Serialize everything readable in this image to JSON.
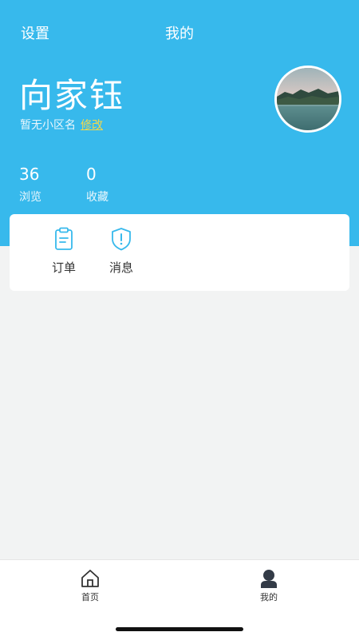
{
  "header": {
    "settings_label": "设置",
    "title": "我的"
  },
  "profile": {
    "name": "向家钰",
    "community": "暂无小区名",
    "edit_label": "修改"
  },
  "stats": [
    {
      "value": "36",
      "label": "浏览"
    },
    {
      "value": "0",
      "label": "收藏"
    }
  ],
  "quick_actions": [
    {
      "label": "订单",
      "icon": "clipboard-icon"
    },
    {
      "label": "消息",
      "icon": "shield-alert-icon"
    }
  ],
  "tabbar": [
    {
      "label": "首页",
      "icon": "home-icon"
    },
    {
      "label": "我的",
      "icon": "user-icon"
    }
  ],
  "colors": {
    "brand": "#37b9ec",
    "edit_link": "#f4d84a",
    "background": "#f2f3f3"
  }
}
